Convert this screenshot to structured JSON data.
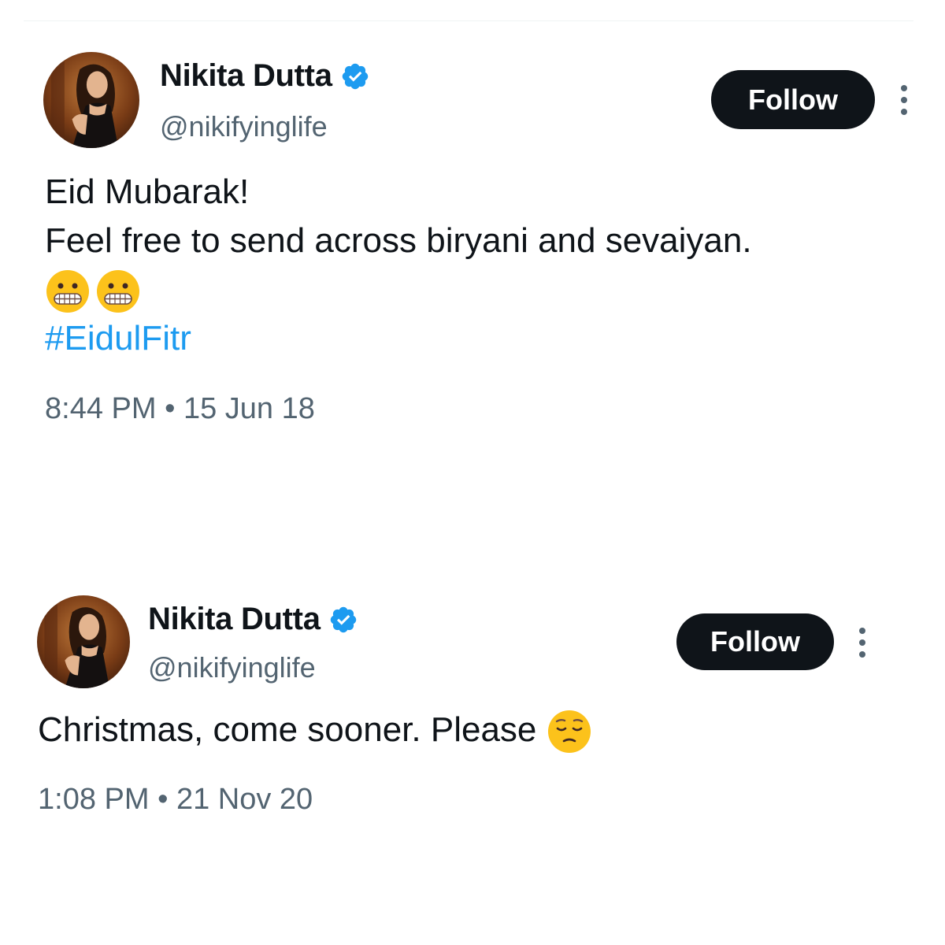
{
  "tweets": [
    {
      "author": {
        "name": "Nikita Dutta",
        "handle": "@nikifyinglife"
      },
      "follow_label": "Follow",
      "text_lines": [
        "Eid Mubarak!",
        "Feel free to send across biryani and sevaiyan."
      ],
      "emojis": [
        "grimacing-face-emoji",
        "grimacing-face-emoji"
      ],
      "hashtag": "#EidulFitr",
      "time": "8:44 PM",
      "separator": "•",
      "date": "15 Jun 18"
    },
    {
      "author": {
        "name": "Nikita Dutta",
        "handle": "@nikifyinglife"
      },
      "follow_label": "Follow",
      "text": "Christmas, come sooner. Please",
      "emojis": [
        "pensive-face-emoji"
      ],
      "time": "1:08 PM",
      "separator": "•",
      "date": "21 Nov 20"
    }
  ],
  "colors": {
    "text_primary": "#0f1419",
    "text_secondary": "#536471",
    "link": "#1d9bf0",
    "verified_badge": "#1d9bf0",
    "follow_button_bg": "#0f1419",
    "follow_button_text": "#ffffff"
  }
}
